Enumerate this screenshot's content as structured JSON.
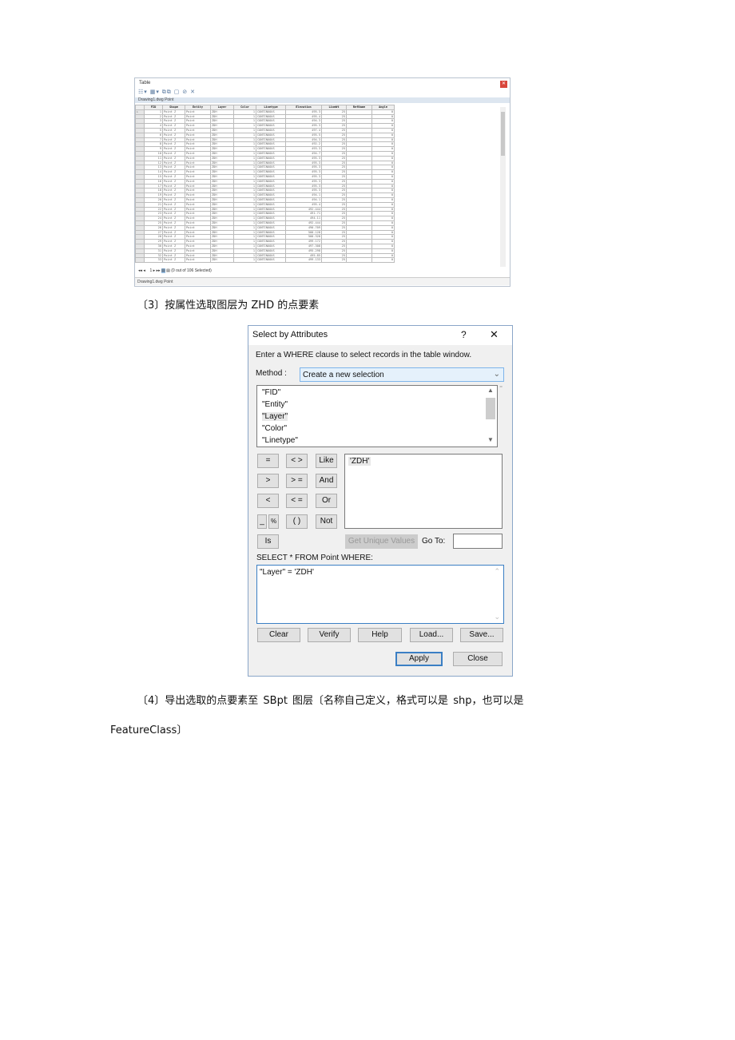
{
  "table_window": {
    "title": "Table",
    "layer_name": "Drawing1.dwg Point",
    "columns": [
      "FID",
      "Shape",
      "Entity",
      "Layer",
      "Color",
      "Linetype",
      "Elevation",
      "LineWt",
      "RefName",
      "Angle"
    ],
    "rows": [
      [
        1,
        "Point Z",
        "Point",
        "ZDH",
        1,
        "CONTINUOUS",
        "495.3",
        25,
        "",
        0
      ],
      [
        2,
        "Point Z",
        "Point",
        "ZDH",
        1,
        "CONTINUOUS",
        "495.4",
        25,
        "",
        0
      ],
      [
        3,
        "Point Z",
        "Point",
        "ZDH",
        1,
        "CONTINUOUS",
        "494.3",
        25,
        "",
        0
      ],
      [
        4,
        "Point Z",
        "Point",
        "ZDH",
        1,
        "CONTINUOUS",
        "495.3",
        25,
        "",
        0
      ],
      [
        5,
        "Point Z",
        "Point",
        "ZDH",
        1,
        "CONTINUOUS",
        "497.4",
        25,
        "",
        0
      ],
      [
        6,
        "Point Z",
        "Point",
        "ZDH",
        1,
        "CONTINUOUS",
        "495.5",
        25,
        "",
        0
      ],
      [
        7,
        "Point Z",
        "Point",
        "ZDH",
        1,
        "CONTINUOUS",
        "494.3",
        25,
        "",
        0
      ],
      [
        8,
        "Point Z",
        "Point",
        "ZDH",
        1,
        "CONTINUOUS",
        "492.2",
        25,
        "",
        0
      ],
      [
        9,
        "Point Z",
        "Point",
        "ZDH",
        1,
        "CONTINUOUS",
        "493.3",
        25,
        "",
        0
      ],
      [
        10,
        "Point Z",
        "Point",
        "ZDH",
        1,
        "CONTINUOUS",
        "494.7",
        25,
        "",
        0
      ],
      [
        11,
        "Point Z",
        "Point",
        "ZDH",
        1,
        "CONTINUOUS",
        "495.3",
        25,
        "",
        0
      ],
      [
        12,
        "Point Z",
        "Point",
        "ZDH",
        1,
        "CONTINUOUS",
        "495.3",
        25,
        "",
        0
      ],
      [
        13,
        "Point Z",
        "Point",
        "ZDH",
        1,
        "CONTINUOUS",
        "495.3",
        25,
        "",
        0
      ],
      [
        14,
        "Point Z",
        "Point",
        "ZDH",
        1,
        "CONTINUOUS",
        "495.3",
        25,
        "",
        0
      ],
      [
        15,
        "Point Z",
        "Point",
        "ZDH",
        1,
        "CONTINUOUS",
        "495.3",
        25,
        "",
        0
      ],
      [
        16,
        "Point Z",
        "Point",
        "ZDH",
        1,
        "CONTINUOUS",
        "495.3",
        25,
        "",
        0
      ],
      [
        17,
        "Point Z",
        "Point",
        "ZDH",
        1,
        "CONTINUOUS",
        "495.3",
        25,
        "",
        0
      ],
      [
        18,
        "Point Z",
        "Point",
        "ZDH",
        1,
        "CONTINUOUS",
        "495.3",
        25,
        "",
        0
      ],
      [
        19,
        "Point Z",
        "Point",
        "ZDH",
        1,
        "CONTINUOUS",
        "494.1",
        25,
        "",
        0
      ],
      [
        20,
        "Point Z",
        "Point",
        "ZDH",
        1,
        "CONTINUOUS",
        "494.1",
        25,
        "",
        0
      ],
      [
        21,
        "Point Z",
        "Point",
        "ZDH",
        1,
        "CONTINUOUS",
        "495.4",
        25,
        "",
        0
      ],
      [
        22,
        "Point Z",
        "Point",
        "ZDH",
        1,
        "CONTINUOUS",
        "492.444",
        25,
        "",
        0
      ],
      [
        23,
        "Point Z",
        "Point",
        "ZDH",
        1,
        "CONTINUOUS",
        "491.71",
        25,
        "",
        0
      ],
      [
        24,
        "Point Z",
        "Point",
        "ZDH",
        1,
        "CONTINUOUS",
        "494.11",
        25,
        "",
        0
      ],
      [
        25,
        "Point Z",
        "Point",
        "ZDH",
        1,
        "CONTINUOUS",
        "492.444",
        25,
        "",
        0
      ],
      [
        26,
        "Point Z",
        "Point",
        "ZDH",
        1,
        "CONTINUOUS",
        "490.709",
        25,
        "",
        0
      ],
      [
        27,
        "Point Z",
        "Point",
        "ZDH",
        1,
        "CONTINUOUS",
        "500.128",
        25,
        "",
        0
      ],
      [
        28,
        "Point Z",
        "Point",
        "ZDH",
        1,
        "CONTINUOUS",
        "500.328",
        25,
        "",
        0
      ],
      [
        29,
        "Point Z",
        "Point",
        "ZDH",
        1,
        "CONTINUOUS",
        "499.172",
        25,
        "",
        0
      ],
      [
        30,
        "Point Z",
        "Point",
        "ZDH",
        1,
        "CONTINUOUS",
        "497.308",
        25,
        "",
        0
      ],
      [
        31,
        "Point Z",
        "Point",
        "ZDH",
        1,
        "CONTINUOUS",
        "495.298",
        25,
        "",
        0
      ],
      [
        32,
        "Point Z",
        "Point",
        "ZDH",
        1,
        "CONTINUOUS",
        "495.85",
        25,
        "",
        0
      ],
      [
        33,
        "Point Z",
        "Point",
        "ZDH",
        1,
        "CONTINUOUS",
        "499.133",
        25,
        "",
        0
      ]
    ],
    "record_position": "1",
    "selection_status": "(0 out of 106 Selected)",
    "tab_label": "Drawing1.dwg Point"
  },
  "step3": "〔3〕按属性选取图层为 ZHD 的点要素",
  "dialog": {
    "title": "Select by Attributes",
    "help": "?",
    "close": "✕",
    "instruction": "Enter a WHERE clause to select records in the table window.",
    "method_label": "Method :",
    "method_value": "Create a new selection",
    "fields": [
      "\"FID\"",
      "\"Entity\"",
      "\"Layer\"",
      "\"Color\"",
      "\"Linetype\""
    ],
    "operators": {
      "eq": "=",
      "ne": "< >",
      "like": "Like",
      "gt": ">",
      "ge": "> =",
      "and": "And",
      "lt": "<",
      "le": "< =",
      "or": "Or",
      "us": "_",
      "pct": "%",
      "paren": "( )",
      "not": "Not",
      "is": "Is"
    },
    "unique_values": [
      "'ZDH'"
    ],
    "get_unique_values": "Get Unique Values",
    "goto_label": "Go To:",
    "goto_value": "",
    "sql_label": "SELECT * FROM Point WHERE:",
    "sql_expression": "\"Layer\" = 'ZDH'",
    "buttons": {
      "clear": "Clear",
      "verify": "Verify",
      "help": "Help",
      "load": "Load...",
      "save": "Save...",
      "apply": "Apply",
      "close": "Close"
    }
  },
  "step4": {
    "line1": "〔4〕导出选取的点要素至  SBpt  图层〔名称自己定义，格式可以是   shp，也可以是",
    "line2": "FeatureClass〕"
  }
}
